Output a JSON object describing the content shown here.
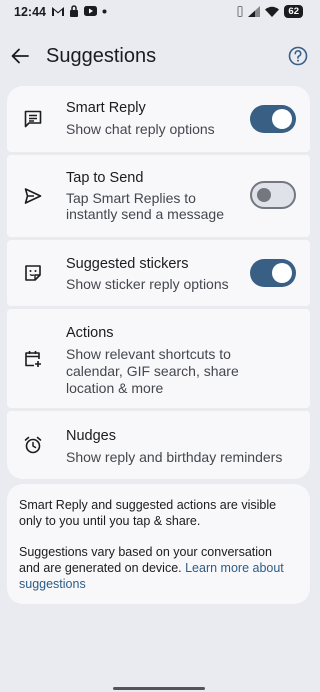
{
  "status": {
    "time": "12:44",
    "battery": "62"
  },
  "header": {
    "title": "Suggestions"
  },
  "rows": [
    {
      "title": "Smart Reply",
      "subtitle": "Show chat reply options",
      "toggle": "on",
      "icon": "chat-bubble-icon"
    },
    {
      "title": "Tap to Send",
      "subtitle_lines": [
        "Tap Smart Replies to",
        "instantly send a message"
      ],
      "toggle": "off",
      "icon": "send-icon"
    },
    {
      "title": "Suggested stickers",
      "subtitle": "Show sticker reply options",
      "toggle": "on",
      "icon": "sticker-icon"
    },
    {
      "title": "Actions",
      "subtitle_lines": [
        "Show relevant shortcuts to",
        "calendar, GIF search, share",
        "location & more"
      ],
      "icon": "calendar-add-icon"
    },
    {
      "title": "Nudges",
      "subtitle": "Show reply and birthday reminders",
      "icon": "alarm-icon"
    }
  ],
  "footer": {
    "para1_lines": [
      "Smart Reply and suggested actions are visible",
      "only to you until you tap & share."
    ],
    "para2_line1": "Suggestions vary based on your conversation",
    "para2_line2_plain": "and are generated on device. ",
    "para2_link_part1": "Learn more about",
    "para2_link_part2": "suggestions"
  },
  "colors": {
    "background": "#e9ebf1",
    "card": "#f8f8fb",
    "toggle_on": "#3a5f85",
    "link": "#2c5d86"
  }
}
